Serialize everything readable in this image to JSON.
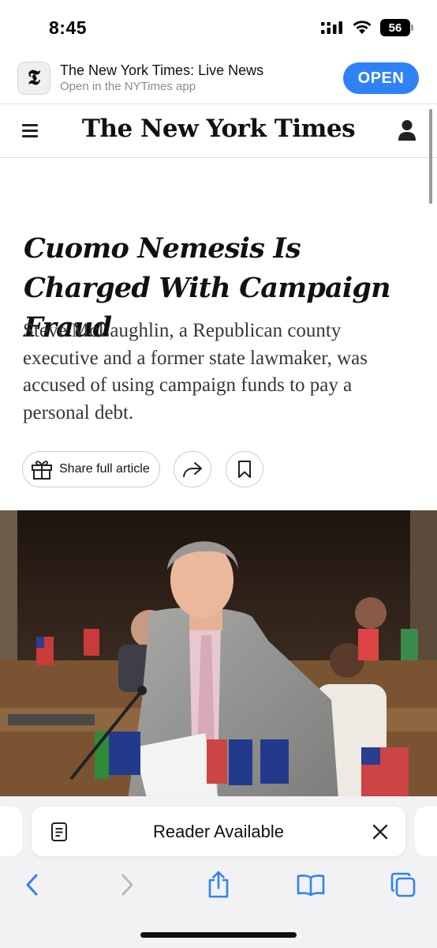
{
  "status_bar": {
    "time": "8:45",
    "battery": "56"
  },
  "app_banner": {
    "icon_letter": "𝕿",
    "title": "The New York Times: Live News",
    "subtitle": "Open in the NYTimes app",
    "open_label": "OPEN"
  },
  "header": {
    "logo": "The New York Times"
  },
  "article": {
    "headline": "Cuomo Nemesis Is Charged With Campaign Fraud",
    "summary": "Steve McLaughlin, a Republican county executive and a former state lawmaker, was accused of using campaign funds to pay a personal debt.",
    "share_label": "Share full article"
  },
  "reader": {
    "label": "Reader Available"
  },
  "colors": {
    "accent": "#2f82f6",
    "toolbar_icon": "#2f82f6",
    "disabled_icon": "#b8b8bd"
  }
}
